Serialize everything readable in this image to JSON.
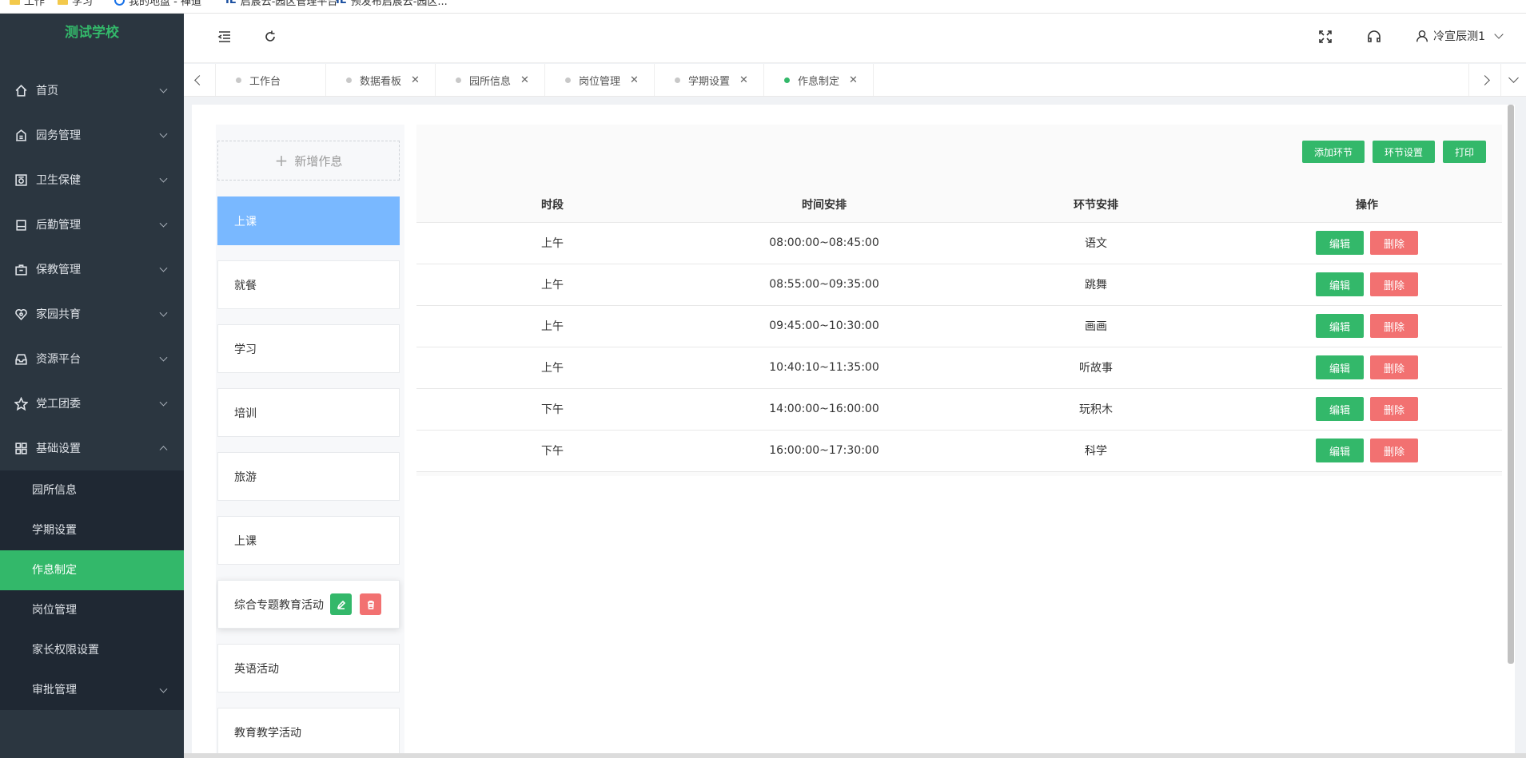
{
  "bookmarks": [
    {
      "label": "工作",
      "icon": "folder-icon"
    },
    {
      "label": "学习",
      "icon": "folder-icon"
    },
    {
      "label": "我的地盘 - 禅道",
      "icon": "globe-icon"
    },
    {
      "label": "启宸云-园区管理平台",
      "icon": "ie-icon"
    },
    {
      "label": "预发布启宸云-园区...",
      "icon": "ie-icon"
    }
  ],
  "sidebar": {
    "logo": "测试学校",
    "menu": [
      {
        "label": "首页",
        "icon": "home-icon"
      },
      {
        "label": "园务管理",
        "icon": "building-icon"
      },
      {
        "label": "卫生保健",
        "icon": "health-icon"
      },
      {
        "label": "后勤管理",
        "icon": "logistics-icon"
      },
      {
        "label": "保教管理",
        "icon": "education-icon"
      },
      {
        "label": "家园共育",
        "icon": "heart-icon"
      },
      {
        "label": "资源平台",
        "icon": "inbox-icon"
      },
      {
        "label": "党工团委",
        "icon": "star-icon"
      },
      {
        "label": "基础设置",
        "icon": "grid-icon"
      }
    ],
    "submenu": [
      {
        "label": "园所信息"
      },
      {
        "label": "学期设置"
      },
      {
        "label": "作息制定"
      },
      {
        "label": "岗位管理"
      },
      {
        "label": "家长权限设置"
      },
      {
        "label": "审批管理"
      }
    ]
  },
  "header": {
    "user_name": "冷宣辰测1"
  },
  "tabs": [
    {
      "label": "工作台",
      "closable": false
    },
    {
      "label": "数据看板",
      "closable": true
    },
    {
      "label": "园所信息",
      "closable": true
    },
    {
      "label": "岗位管理",
      "closable": true
    },
    {
      "label": "学期设置",
      "closable": true
    },
    {
      "label": "作息制定",
      "closable": true,
      "active": true
    }
  ],
  "left_panel": {
    "add_label": "新增作息",
    "cards": [
      {
        "label": "上课"
      },
      {
        "label": "就餐"
      },
      {
        "label": "学习"
      },
      {
        "label": "培训"
      },
      {
        "label": "旅游"
      },
      {
        "label": "上课"
      },
      {
        "label": "综合专题教育活动"
      },
      {
        "label": "英语活动"
      },
      {
        "label": "教育教学活动"
      }
    ]
  },
  "right_panel": {
    "actions": {
      "add": "添加环节",
      "settings": "环节设置",
      "print": "打印"
    },
    "columns": [
      "时段",
      "时间安排",
      "环节安排",
      "操作"
    ],
    "rows": [
      {
        "period": "上午",
        "time": "08:00:00~08:45:00",
        "activity": "语文"
      },
      {
        "period": "上午",
        "time": "08:55:00~09:35:00",
        "activity": "跳舞"
      },
      {
        "period": "上午",
        "time": "09:45:00~10:30:00",
        "activity": "画画"
      },
      {
        "period": "上午",
        "time": "10:40:10~11:35:00",
        "activity": "听故事"
      },
      {
        "period": "下午",
        "time": "14:00:00~16:00:00",
        "activity": "玩积木"
      },
      {
        "period": "下午",
        "time": "16:00:00~17:30:00",
        "activity": "科学"
      }
    ],
    "edit_label": "编辑",
    "delete_label": "删除"
  },
  "colors": {
    "primary": "#33b86a",
    "danger": "#f27171",
    "selected": "#79b8ff",
    "sidebar": "#2b3640"
  }
}
